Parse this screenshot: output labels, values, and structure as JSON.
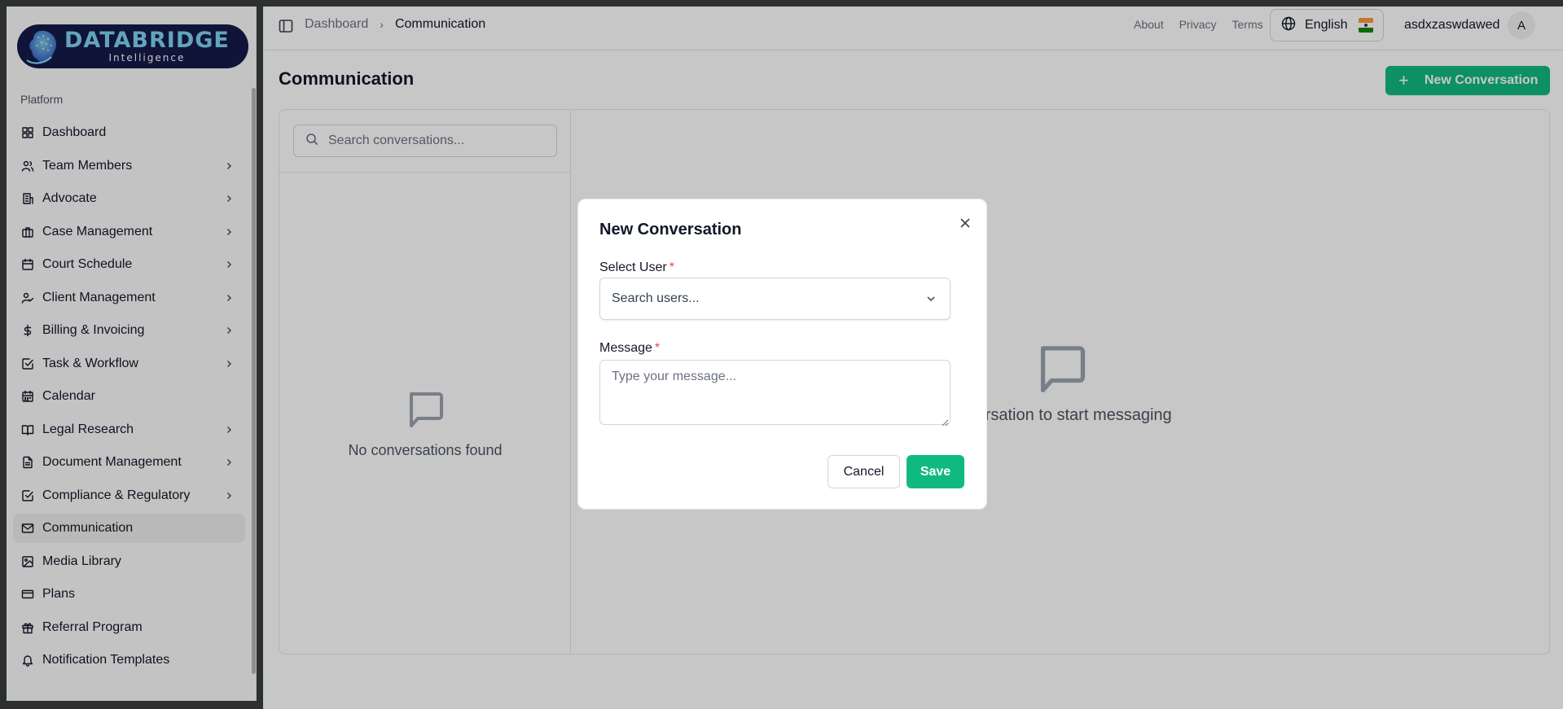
{
  "brand": {
    "name": "DATABRIDGE",
    "tagline": "Intelligence"
  },
  "sidebar": {
    "section_label": "Platform",
    "items": [
      {
        "label": "Dashboard",
        "icon": "grid-icon",
        "has_children": false,
        "active": false
      },
      {
        "label": "Team Members",
        "icon": "users-icon",
        "has_children": true,
        "active": false
      },
      {
        "label": "Advocate",
        "icon": "building-icon",
        "has_children": true,
        "active": false
      },
      {
        "label": "Case Management",
        "icon": "briefcase-icon",
        "has_children": true,
        "active": false
      },
      {
        "label": "Court Schedule",
        "icon": "calendar-icon",
        "has_children": true,
        "active": false
      },
      {
        "label": "Client Management",
        "icon": "user-check-icon",
        "has_children": true,
        "active": false
      },
      {
        "label": "Billing & Invoicing",
        "icon": "dollar-icon",
        "has_children": true,
        "active": false
      },
      {
        "label": "Task & Workflow",
        "icon": "check-square-icon",
        "has_children": true,
        "active": false
      },
      {
        "label": "Calendar",
        "icon": "calendar-days-icon",
        "has_children": false,
        "active": false
      },
      {
        "label": "Legal Research",
        "icon": "book-open-icon",
        "has_children": true,
        "active": false
      },
      {
        "label": "Document Management",
        "icon": "file-text-icon",
        "has_children": true,
        "active": false
      },
      {
        "label": "Compliance & Regulatory",
        "icon": "check-square-icon",
        "has_children": true,
        "active": false
      },
      {
        "label": "Communication",
        "icon": "mail-icon",
        "has_children": false,
        "active": true
      },
      {
        "label": "Media Library",
        "icon": "image-icon",
        "has_children": false,
        "active": false
      },
      {
        "label": "Plans",
        "icon": "credit-card-icon",
        "has_children": false,
        "active": false
      },
      {
        "label": "Referral Program",
        "icon": "gift-icon",
        "has_children": false,
        "active": false
      },
      {
        "label": "Notification Templates",
        "icon": "bell-icon",
        "has_children": false,
        "active": false
      }
    ]
  },
  "header": {
    "breadcrumb": [
      "Dashboard",
      "Communication"
    ],
    "links": [
      "About",
      "Privacy",
      "Terms"
    ],
    "language": "English",
    "username": "asdxzaswdawed",
    "avatar_initial": "A"
  },
  "page": {
    "title": "Communication",
    "new_button": "New Conversation",
    "search_placeholder": "Search conversations...",
    "empty_left": "No conversations found",
    "empty_right": "onversation to start messaging"
  },
  "modal": {
    "title": "New Conversation",
    "select_label": "Select User",
    "select_placeholder": "Search users...",
    "message_label": "Message",
    "message_placeholder": "Type your message...",
    "required_mark": "*",
    "cancel": "Cancel",
    "save": "Save"
  },
  "colors": {
    "accent": "#10b981",
    "brand_bg": "#151a4a",
    "brand_text": "#7fd3f2",
    "required": "#ef4444"
  }
}
